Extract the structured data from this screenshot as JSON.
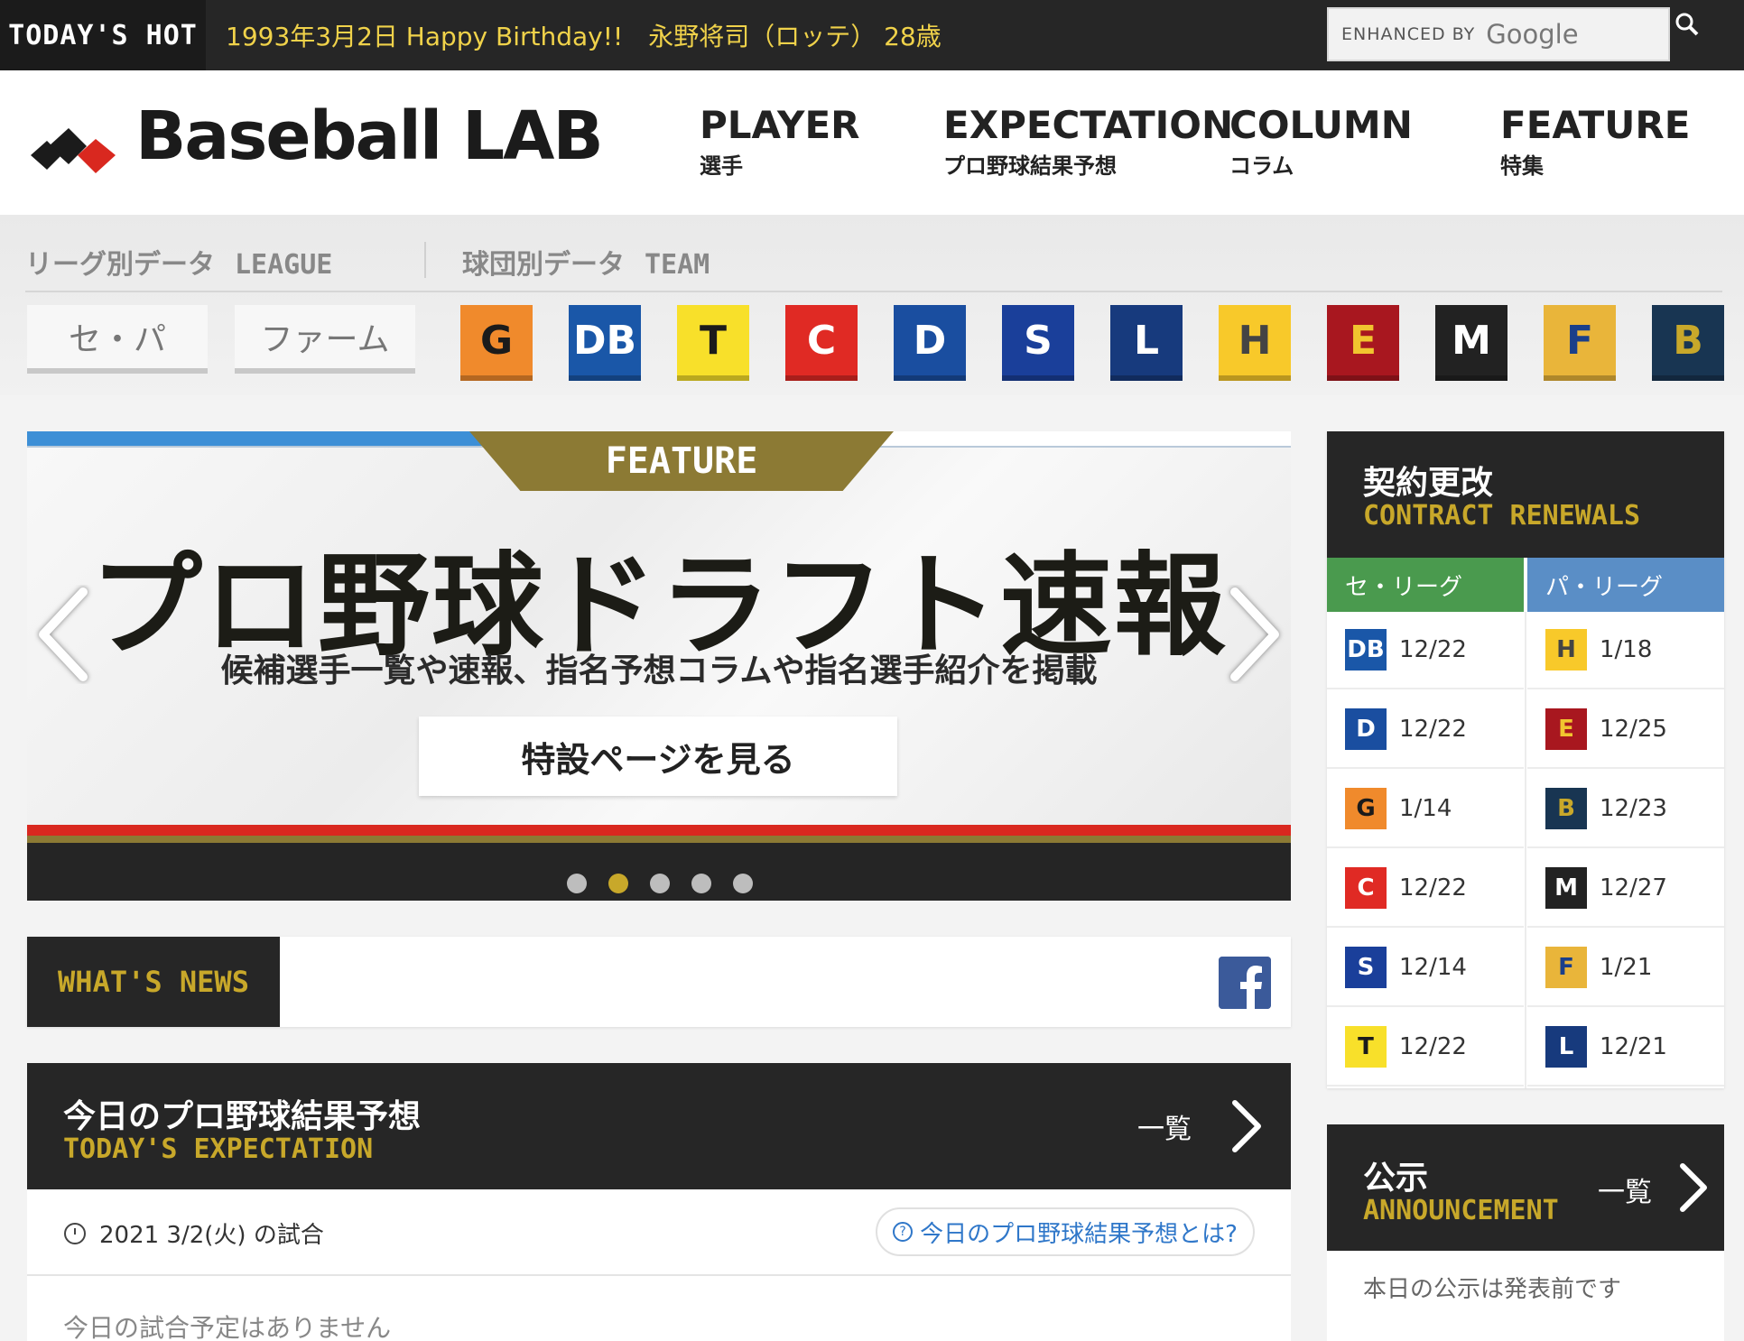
{
  "topbar": {
    "hot_label": "TODAY'S HOT",
    "ticker": "1993年3月2日 Happy Birthday!!　永野将司（ロッテ） 28歳",
    "search_enhanced": "ENHANCED BY",
    "search_google": "Google"
  },
  "header": {
    "logo": "Baseball LAB",
    "nav": [
      {
        "en": "PLAYER",
        "jp": "選手"
      },
      {
        "en": "EXPECTATION",
        "jp": "プロ野球結果予想"
      },
      {
        "en": "COLUMN",
        "jp": "コラム"
      },
      {
        "en": "FEATURE",
        "jp": "特集"
      }
    ]
  },
  "band": {
    "league_jp": "リーグ別データ",
    "league_en": "LEAGUE",
    "team_jp": "球団別データ",
    "team_en": "TEAM",
    "league_tabs": [
      "セ・パ",
      "ファーム"
    ],
    "teams": [
      {
        "code": "G",
        "bg": "#f08a2c",
        "fg": "#1b1b1b"
      },
      {
        "code": "DB",
        "bg": "#1a57a8",
        "fg": "#ffffff"
      },
      {
        "code": "T",
        "bg": "#f8e02a",
        "fg": "#1b1b1b"
      },
      {
        "code": "C",
        "bg": "#e02a24",
        "fg": "#ffffff"
      },
      {
        "code": "D",
        "bg": "#1a4ea0",
        "fg": "#ffffff"
      },
      {
        "code": "S",
        "bg": "#1a3f9a",
        "fg": "#ffffff"
      },
      {
        "code": "L",
        "bg": "#173a7d",
        "fg": "#ffffff"
      },
      {
        "code": "H",
        "bg": "#f8c92a",
        "fg": "#444444"
      },
      {
        "code": "E",
        "bg": "#a8171f",
        "fg": "#f1c52f"
      },
      {
        "code": "M",
        "bg": "#222222",
        "fg": "#ffffff"
      },
      {
        "code": "F",
        "bg": "#e9b53a",
        "fg": "#1a3f8a"
      },
      {
        "code": "B",
        "bg": "#183552",
        "fg": "#c8a82a"
      }
    ]
  },
  "slider": {
    "ribbon": "FEATURE",
    "headline": "プロ野球ドラフト速報",
    "sub": "候補選手一覧や速報、指名予想コラムや指名選手紹介を掲載",
    "cta": "特設ページを見る",
    "dots": 5,
    "active_dot": 1
  },
  "news": {
    "label": "WHAT'S NEWS"
  },
  "expectation": {
    "title_jp": "今日のプロ野球結果予想",
    "title_en": "TODAY'S EXPECTATION",
    "more": "一覧",
    "date": "2021 3/2(火) の試合",
    "whatis": "今日のプロ野球結果予想とは?",
    "none": "今日の試合予定はありません"
  },
  "contract": {
    "title_jp": "契約更改",
    "title_en": "CONTRACT RENEWALS",
    "central_label": "セ・リーグ",
    "pacific_label": "パ・リーグ",
    "central_color": "#4a9a4e",
    "pacific_color": "#5a8ec6",
    "central": [
      {
        "code": "DB",
        "date": "12/22",
        "bg": "#1a57a8",
        "fg": "#ffffff"
      },
      {
        "code": "D",
        "date": "12/22",
        "bg": "#1a4ea0",
        "fg": "#ffffff"
      },
      {
        "code": "G",
        "date": "1/14",
        "bg": "#f08a2c",
        "fg": "#1b1b1b"
      },
      {
        "code": "C",
        "date": "12/22",
        "bg": "#e02a24",
        "fg": "#ffffff"
      },
      {
        "code": "S",
        "date": "12/14",
        "bg": "#1a3f9a",
        "fg": "#ffffff"
      },
      {
        "code": "T",
        "date": "12/22",
        "bg": "#f8e02a",
        "fg": "#1b1b1b"
      }
    ],
    "pacific": [
      {
        "code": "H",
        "date": "1/18",
        "bg": "#f8c92a",
        "fg": "#444444"
      },
      {
        "code": "E",
        "date": "12/25",
        "bg": "#a8171f",
        "fg": "#f1c52f"
      },
      {
        "code": "B",
        "date": "12/23",
        "bg": "#183552",
        "fg": "#c8a82a"
      },
      {
        "code": "M",
        "date": "12/27",
        "bg": "#222222",
        "fg": "#ffffff"
      },
      {
        "code": "F",
        "date": "1/21",
        "bg": "#e9b53a",
        "fg": "#1a3f8a"
      },
      {
        "code": "L",
        "date": "12/21",
        "bg": "#173a7d",
        "fg": "#ffffff"
      }
    ]
  },
  "announcement": {
    "title_jp": "公示",
    "title_en": "ANNOUNCEMENT",
    "more": "一覧",
    "text": "本日の公示は発表前です"
  }
}
